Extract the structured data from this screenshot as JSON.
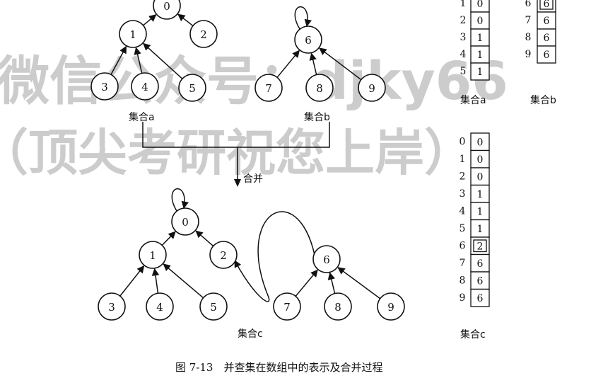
{
  "watermark": {
    "line1": "微信公众号：djky66",
    "line2": "（顶尖考研祝您上岸）"
  },
  "caption": "图 7-13　并查集在数组中的表示及合并过程",
  "merge_label": "合并",
  "trees": {
    "a": {
      "label": "集合a",
      "root_self_loop": false,
      "nodes": [
        "0",
        "1",
        "2",
        "3",
        "4",
        "5"
      ],
      "edges": [
        [
          "1",
          "0"
        ],
        [
          "2",
          "0"
        ],
        [
          "3",
          "1"
        ],
        [
          "4",
          "1"
        ],
        [
          "5",
          "1"
        ]
      ]
    },
    "b": {
      "label": "集合b",
      "root_self_loop": true,
      "nodes": [
        "6",
        "7",
        "8",
        "9"
      ],
      "edges": [
        [
          "7",
          "6"
        ],
        [
          "8",
          "6"
        ],
        [
          "9",
          "6"
        ]
      ]
    },
    "c": {
      "label": "集合c",
      "root_self_loop": true,
      "nodes": [
        "0",
        "1",
        "2",
        "3",
        "4",
        "5",
        "6",
        "7",
        "8",
        "9"
      ],
      "edges": [
        [
          "1",
          "0"
        ],
        [
          "2",
          "0"
        ],
        [
          "3",
          "1"
        ],
        [
          "4",
          "1"
        ],
        [
          "5",
          "1"
        ],
        [
          "7",
          "6"
        ],
        [
          "8",
          "6"
        ],
        [
          "9",
          "6"
        ],
        [
          "6",
          "2"
        ]
      ]
    }
  },
  "arrays": {
    "a": {
      "label": "集合a",
      "indices": [
        "1",
        "2",
        "3",
        "4",
        "5"
      ],
      "values": [
        "0",
        "0",
        "1",
        "1",
        "1"
      ],
      "highlight_index": null
    },
    "b": {
      "label": "集合b",
      "indices": [
        "6",
        "7",
        "8",
        "9"
      ],
      "values": [
        "6",
        "6",
        "6",
        "6"
      ],
      "highlight_index": "6"
    },
    "c": {
      "label": "集合c",
      "indices": [
        "0",
        "1",
        "2",
        "3",
        "4",
        "5",
        "6",
        "7",
        "8",
        "9"
      ],
      "values": [
        "0",
        "0",
        "0",
        "1",
        "1",
        "1",
        "2",
        "6",
        "6",
        "6"
      ],
      "highlight_index": "6"
    }
  }
}
